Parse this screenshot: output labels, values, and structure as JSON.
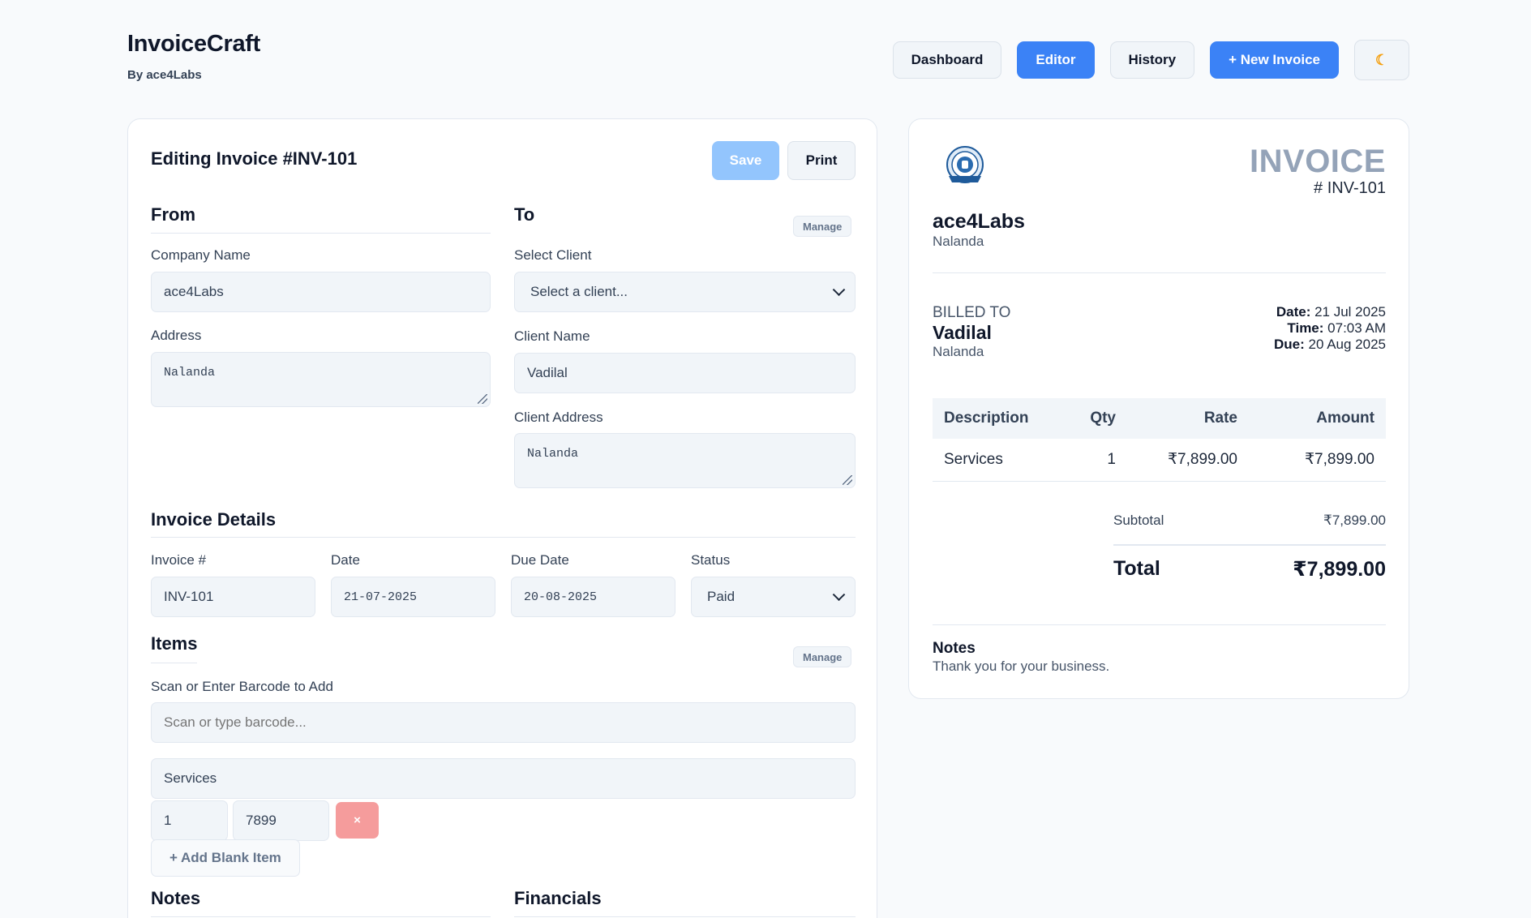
{
  "app": {
    "title": "InvoiceCraft",
    "subtitle": "By ace4Labs"
  },
  "nav": {
    "dashboard": "Dashboard",
    "editor": "Editor",
    "history": "History",
    "new_invoice": "+ New Invoice",
    "theme_icon": "moon-icon",
    "theme_glyph": "☾"
  },
  "editor": {
    "title": "Editing Invoice #INV-101",
    "save": "Save",
    "print": "Print",
    "from": {
      "title": "From",
      "company_label": "Company Name",
      "company_value": "ace4Labs",
      "address_label": "Address",
      "address_value": "Nalanda"
    },
    "to": {
      "title": "To",
      "manage": "Manage",
      "select_label": "Select Client",
      "select_value": "Select a client...",
      "name_label": "Client Name",
      "name_value": "Vadilal",
      "address_label": "Client Address",
      "address_value": "Nalanda"
    },
    "details": {
      "title": "Invoice Details",
      "number_label": "Invoice #",
      "number_value": "INV-101",
      "date_label": "Date",
      "date_value": "21-07-2025",
      "due_label": "Due Date",
      "due_value": "20-08-2025",
      "status_label": "Status",
      "status_value": "Paid"
    },
    "items": {
      "title": "Items",
      "manage": "Manage",
      "barcode_label": "Scan or Enter Barcode to Add",
      "barcode_placeholder": "Scan or type barcode...",
      "rows": [
        {
          "description": "Services",
          "qty": "1",
          "rate": "7899"
        }
      ],
      "delete_glyph": "×",
      "add_blank": "+ Add Blank Item"
    },
    "notes_title": "Notes",
    "financials_title": "Financials"
  },
  "preview": {
    "heading": "INVOICE",
    "number": "# INV-101",
    "from_name": "ace4Labs",
    "from_address": "Nalanda",
    "billed_label": "BILLED TO",
    "billed_name": "Vadilal",
    "billed_address": "Nalanda",
    "date_label": "Date:",
    "date_value": "21 Jul 2025",
    "time_label": "Time:",
    "time_value": "07:03 AM",
    "due_label": "Due:",
    "due_value": "20 Aug 2025",
    "table": {
      "headers": [
        "Description",
        "Qty",
        "Rate",
        "Amount"
      ],
      "rows": [
        {
          "description": "Services",
          "qty": "1",
          "rate": "₹7,899.00",
          "amount": "₹7,899.00"
        }
      ]
    },
    "subtotal_label": "Subtotal",
    "subtotal_value": "₹7,899.00",
    "total_label": "Total",
    "total_value": "₹7,899.00",
    "notes_title": "Notes",
    "notes_text": "Thank you for your business."
  },
  "colors": {
    "primary": "#3b82f6",
    "save_disabled": "#93c5fd",
    "danger": "#f59c9c"
  }
}
